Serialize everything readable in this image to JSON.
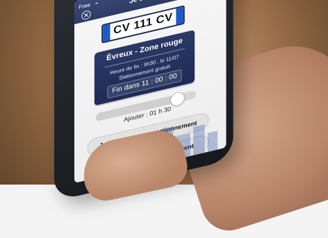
{
  "status_bar": {
    "carrier": "Free",
    "wifi_icon": "wifi-icon"
  },
  "header": {
    "title": "Je stationne",
    "close_icon": "close-icon"
  },
  "plate": {
    "text": "CV 111 CV"
  },
  "parking": {
    "zone": "Évreux - Zone rouge",
    "end_time": "Heure de fin : 9h30 , le 11/07",
    "free_parking": "Stationnement gratuit",
    "countdown": "Fin dans 11 : 00 : 00"
  },
  "add_time": {
    "label": "Ajouter : 01 h 30",
    "slider_fraction": 0.78
  },
  "actions": {
    "extend_label": "Je prolonge mon stationnement",
    "stop_label": "Je stoppe mon stationnement"
  },
  "colors": {
    "header": "#2d3b66",
    "card": "#1f2b55",
    "plate_blue": "#1f5ac8"
  }
}
